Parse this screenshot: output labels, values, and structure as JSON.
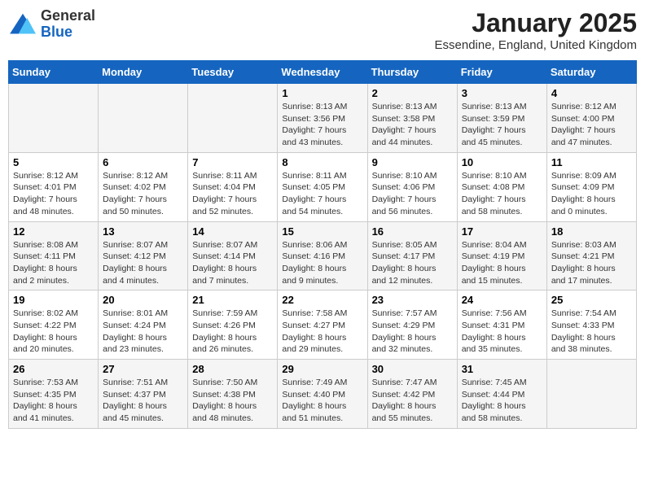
{
  "logo": {
    "general": "General",
    "blue": "Blue"
  },
  "header": {
    "month": "January 2025",
    "location": "Essendine, England, United Kingdom"
  },
  "weekdays": [
    "Sunday",
    "Monday",
    "Tuesday",
    "Wednesday",
    "Thursday",
    "Friday",
    "Saturday"
  ],
  "weeks": [
    [
      {
        "day": "",
        "info": ""
      },
      {
        "day": "",
        "info": ""
      },
      {
        "day": "",
        "info": ""
      },
      {
        "day": "1",
        "info": "Sunrise: 8:13 AM\nSunset: 3:56 PM\nDaylight: 7 hours and 43 minutes."
      },
      {
        "day": "2",
        "info": "Sunrise: 8:13 AM\nSunset: 3:58 PM\nDaylight: 7 hours and 44 minutes."
      },
      {
        "day": "3",
        "info": "Sunrise: 8:13 AM\nSunset: 3:59 PM\nDaylight: 7 hours and 45 minutes."
      },
      {
        "day": "4",
        "info": "Sunrise: 8:12 AM\nSunset: 4:00 PM\nDaylight: 7 hours and 47 minutes."
      }
    ],
    [
      {
        "day": "5",
        "info": "Sunrise: 8:12 AM\nSunset: 4:01 PM\nDaylight: 7 hours and 48 minutes."
      },
      {
        "day": "6",
        "info": "Sunrise: 8:12 AM\nSunset: 4:02 PM\nDaylight: 7 hours and 50 minutes."
      },
      {
        "day": "7",
        "info": "Sunrise: 8:11 AM\nSunset: 4:04 PM\nDaylight: 7 hours and 52 minutes."
      },
      {
        "day": "8",
        "info": "Sunrise: 8:11 AM\nSunset: 4:05 PM\nDaylight: 7 hours and 54 minutes."
      },
      {
        "day": "9",
        "info": "Sunrise: 8:10 AM\nSunset: 4:06 PM\nDaylight: 7 hours and 56 minutes."
      },
      {
        "day": "10",
        "info": "Sunrise: 8:10 AM\nSunset: 4:08 PM\nDaylight: 7 hours and 58 minutes."
      },
      {
        "day": "11",
        "info": "Sunrise: 8:09 AM\nSunset: 4:09 PM\nDaylight: 8 hours and 0 minutes."
      }
    ],
    [
      {
        "day": "12",
        "info": "Sunrise: 8:08 AM\nSunset: 4:11 PM\nDaylight: 8 hours and 2 minutes."
      },
      {
        "day": "13",
        "info": "Sunrise: 8:07 AM\nSunset: 4:12 PM\nDaylight: 8 hours and 4 minutes."
      },
      {
        "day": "14",
        "info": "Sunrise: 8:07 AM\nSunset: 4:14 PM\nDaylight: 8 hours and 7 minutes."
      },
      {
        "day": "15",
        "info": "Sunrise: 8:06 AM\nSunset: 4:16 PM\nDaylight: 8 hours and 9 minutes."
      },
      {
        "day": "16",
        "info": "Sunrise: 8:05 AM\nSunset: 4:17 PM\nDaylight: 8 hours and 12 minutes."
      },
      {
        "day": "17",
        "info": "Sunrise: 8:04 AM\nSunset: 4:19 PM\nDaylight: 8 hours and 15 minutes."
      },
      {
        "day": "18",
        "info": "Sunrise: 8:03 AM\nSunset: 4:21 PM\nDaylight: 8 hours and 17 minutes."
      }
    ],
    [
      {
        "day": "19",
        "info": "Sunrise: 8:02 AM\nSunset: 4:22 PM\nDaylight: 8 hours and 20 minutes."
      },
      {
        "day": "20",
        "info": "Sunrise: 8:01 AM\nSunset: 4:24 PM\nDaylight: 8 hours and 23 minutes."
      },
      {
        "day": "21",
        "info": "Sunrise: 7:59 AM\nSunset: 4:26 PM\nDaylight: 8 hours and 26 minutes."
      },
      {
        "day": "22",
        "info": "Sunrise: 7:58 AM\nSunset: 4:27 PM\nDaylight: 8 hours and 29 minutes."
      },
      {
        "day": "23",
        "info": "Sunrise: 7:57 AM\nSunset: 4:29 PM\nDaylight: 8 hours and 32 minutes."
      },
      {
        "day": "24",
        "info": "Sunrise: 7:56 AM\nSunset: 4:31 PM\nDaylight: 8 hours and 35 minutes."
      },
      {
        "day": "25",
        "info": "Sunrise: 7:54 AM\nSunset: 4:33 PM\nDaylight: 8 hours and 38 minutes."
      }
    ],
    [
      {
        "day": "26",
        "info": "Sunrise: 7:53 AM\nSunset: 4:35 PM\nDaylight: 8 hours and 41 minutes."
      },
      {
        "day": "27",
        "info": "Sunrise: 7:51 AM\nSunset: 4:37 PM\nDaylight: 8 hours and 45 minutes."
      },
      {
        "day": "28",
        "info": "Sunrise: 7:50 AM\nSunset: 4:38 PM\nDaylight: 8 hours and 48 minutes."
      },
      {
        "day": "29",
        "info": "Sunrise: 7:49 AM\nSunset: 4:40 PM\nDaylight: 8 hours and 51 minutes."
      },
      {
        "day": "30",
        "info": "Sunrise: 7:47 AM\nSunset: 4:42 PM\nDaylight: 8 hours and 55 minutes."
      },
      {
        "day": "31",
        "info": "Sunrise: 7:45 AM\nSunset: 4:44 PM\nDaylight: 8 hours and 58 minutes."
      },
      {
        "day": "",
        "info": ""
      }
    ]
  ]
}
